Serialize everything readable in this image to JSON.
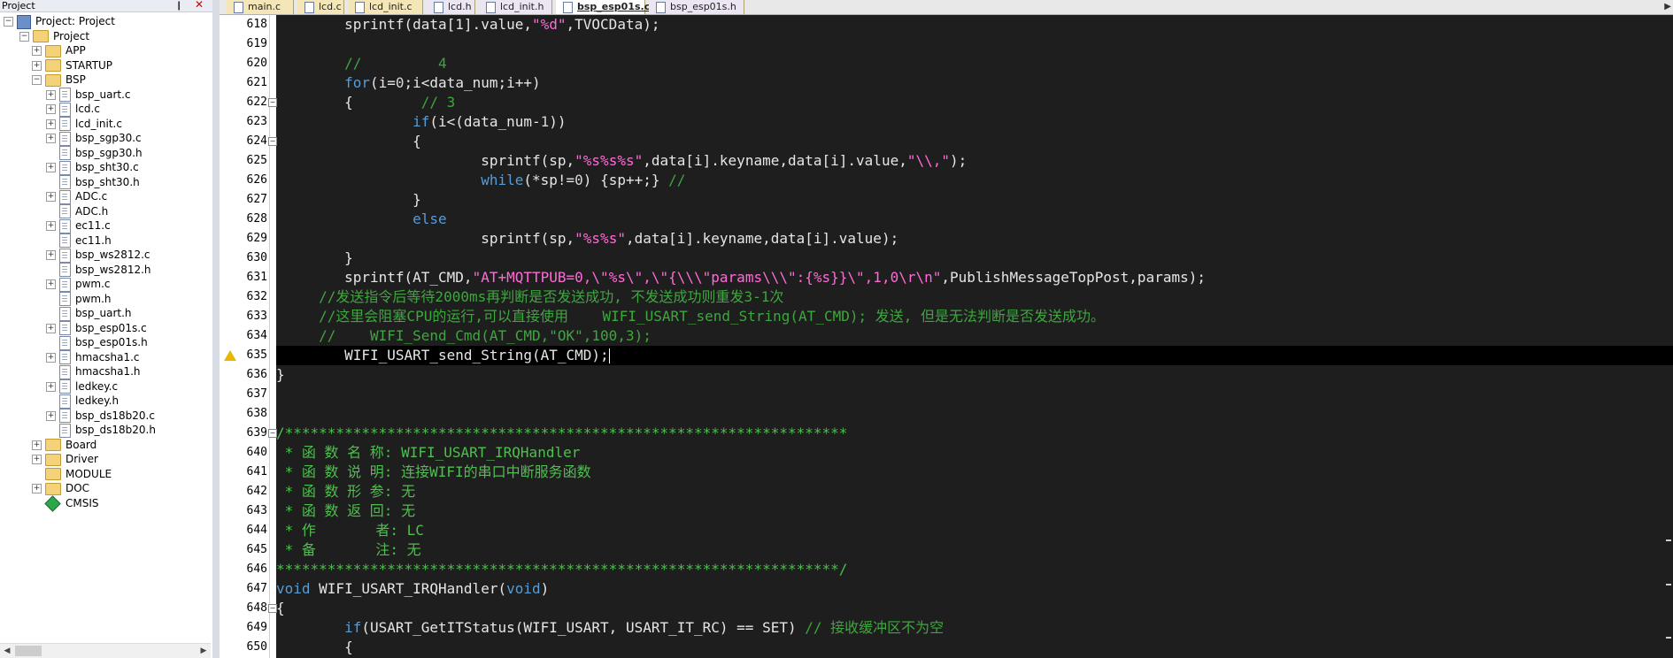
{
  "project_panel": {
    "title": "Project",
    "pin_glyph": "❙",
    "close_glyph": "✕",
    "tree": [
      {
        "label": "Project: Project",
        "indent": 0,
        "icon": "project-icon",
        "expander": "-"
      },
      {
        "label": "Project",
        "indent": 1,
        "icon": "folder-icon",
        "expander": "-"
      },
      {
        "label": "APP",
        "indent": 2,
        "icon": "folder-icon",
        "expander": "+"
      },
      {
        "label": "STARTUP",
        "indent": 2,
        "icon": "folder-icon",
        "expander": "+"
      },
      {
        "label": "BSP",
        "indent": 2,
        "icon": "folder-icon",
        "expander": "-"
      },
      {
        "label": "bsp_uart.c",
        "indent": 3,
        "icon": "file-icon",
        "expander": "+"
      },
      {
        "label": "lcd.c",
        "indent": 3,
        "icon": "file-icon",
        "expander": "+"
      },
      {
        "label": "lcd_init.c",
        "indent": 3,
        "icon": "file-icon",
        "expander": "+"
      },
      {
        "label": "bsp_sgp30.c",
        "indent": 3,
        "icon": "file-icon",
        "expander": "+"
      },
      {
        "label": "bsp_sgp30.h",
        "indent": 3,
        "icon": "file-icon",
        "expander": ""
      },
      {
        "label": "bsp_sht30.c",
        "indent": 3,
        "icon": "file-icon",
        "expander": "+"
      },
      {
        "label": "bsp_sht30.h",
        "indent": 3,
        "icon": "file-icon",
        "expander": ""
      },
      {
        "label": "ADC.c",
        "indent": 3,
        "icon": "file-icon",
        "expander": "+"
      },
      {
        "label": "ADC.h",
        "indent": 3,
        "icon": "file-icon",
        "expander": ""
      },
      {
        "label": "ec11.c",
        "indent": 3,
        "icon": "file-icon",
        "expander": "+"
      },
      {
        "label": "ec11.h",
        "indent": 3,
        "icon": "file-icon",
        "expander": ""
      },
      {
        "label": "bsp_ws2812.c",
        "indent": 3,
        "icon": "file-icon",
        "expander": "+"
      },
      {
        "label": "bsp_ws2812.h",
        "indent": 3,
        "icon": "file-icon",
        "expander": ""
      },
      {
        "label": "pwm.c",
        "indent": 3,
        "icon": "file-icon",
        "expander": "+"
      },
      {
        "label": "pwm.h",
        "indent": 3,
        "icon": "file-icon",
        "expander": ""
      },
      {
        "label": "bsp_uart.h",
        "indent": 3,
        "icon": "file-icon",
        "expander": ""
      },
      {
        "label": "bsp_esp01s.c",
        "indent": 3,
        "icon": "file-icon",
        "expander": "+"
      },
      {
        "label": "bsp_esp01s.h",
        "indent": 3,
        "icon": "file-icon",
        "expander": ""
      },
      {
        "label": "hmacsha1.c",
        "indent": 3,
        "icon": "file-icon",
        "expander": "+"
      },
      {
        "label": "hmacsha1.h",
        "indent": 3,
        "icon": "file-icon",
        "expander": ""
      },
      {
        "label": "ledkey.c",
        "indent": 3,
        "icon": "file-icon",
        "expander": "+"
      },
      {
        "label": "ledkey.h",
        "indent": 3,
        "icon": "file-icon",
        "expander": ""
      },
      {
        "label": "bsp_ds18b20.c",
        "indent": 3,
        "icon": "file-icon",
        "expander": "+"
      },
      {
        "label": "bsp_ds18b20.h",
        "indent": 3,
        "icon": "file-icon",
        "expander": ""
      },
      {
        "label": "Board",
        "indent": 2,
        "icon": "folder-icon",
        "expander": "+"
      },
      {
        "label": "Driver",
        "indent": 2,
        "icon": "folder-icon",
        "expander": "+"
      },
      {
        "label": "MODULE",
        "indent": 2,
        "icon": "folder-icon",
        "expander": ""
      },
      {
        "label": "DOC",
        "indent": 2,
        "icon": "folder-icon",
        "expander": "+"
      },
      {
        "label": "CMSIS",
        "indent": 2,
        "icon": "gem-icon",
        "expander": ""
      }
    ]
  },
  "tabs": [
    {
      "label": "main.c",
      "active": false,
      "kind": "c"
    },
    {
      "label": "lcd.c",
      "active": false,
      "kind": "c"
    },
    {
      "label": "lcd_init.c",
      "active": false,
      "kind": "c"
    },
    {
      "label": "lcd.h",
      "active": false,
      "kind": "h"
    },
    {
      "label": "lcd_init.h",
      "active": false,
      "kind": "h"
    },
    {
      "label": "bsp_esp01s.c",
      "active": true,
      "kind": "c"
    },
    {
      "label": "bsp_esp01s.h",
      "active": false,
      "kind": "h"
    }
  ],
  "editor": {
    "current_line": 635,
    "warning_line": 635,
    "lines": [
      {
        "n": 618,
        "fold": "",
        "parts": [
          [
            "p",
            "        sprintf(data[1].value,"
          ],
          [
            "s",
            "\"%d\""
          ],
          [
            "p",
            ",TVOCData);"
          ]
        ]
      },
      {
        "n": 619,
        "fold": "",
        "parts": []
      },
      {
        "n": 620,
        "fold": "",
        "parts": [
          [
            "c",
            "        //         4"
          ]
        ]
      },
      {
        "n": 621,
        "fold": "",
        "parts": [
          [
            "p",
            "        "
          ],
          [
            "k",
            "for"
          ],
          [
            "p",
            "(i="
          ],
          [
            "n",
            "0"
          ],
          [
            "p",
            ";i<data_num;i++)"
          ]
        ]
      },
      {
        "n": 622,
        "fold": "-",
        "parts": [
          [
            "p",
            "        {        "
          ],
          [
            "c",
            "// 3"
          ]
        ]
      },
      {
        "n": 623,
        "fold": "",
        "parts": [
          [
            "p",
            "                "
          ],
          [
            "k",
            "if"
          ],
          [
            "p",
            "(i<(data_num-"
          ],
          [
            "n",
            "1"
          ],
          [
            "p",
            "))"
          ]
        ]
      },
      {
        "n": 624,
        "fold": "-",
        "parts": [
          [
            "p",
            "                {"
          ]
        ]
      },
      {
        "n": 625,
        "fold": "",
        "parts": [
          [
            "p",
            "                        sprintf(sp,"
          ],
          [
            "s",
            "\"%s%s%s\""
          ],
          [
            "p",
            ",data[i].keyname,data[i].value,"
          ],
          [
            "s",
            "\"\\\\,\""
          ],
          [
            "p",
            ");"
          ]
        ]
      },
      {
        "n": 626,
        "fold": "",
        "parts": [
          [
            "p",
            "                        "
          ],
          [
            "k",
            "while"
          ],
          [
            "p",
            "(*sp!="
          ],
          [
            "n",
            "0"
          ],
          [
            "p",
            ") {sp++;} "
          ],
          [
            "c",
            "//"
          ]
        ]
      },
      {
        "n": 627,
        "fold": "",
        "parts": [
          [
            "p",
            "                }"
          ]
        ]
      },
      {
        "n": 628,
        "fold": "",
        "parts": [
          [
            "p",
            "                "
          ],
          [
            "k",
            "else"
          ]
        ]
      },
      {
        "n": 629,
        "fold": "",
        "parts": [
          [
            "p",
            "                        sprintf(sp,"
          ],
          [
            "s",
            "\"%s%s\""
          ],
          [
            "p",
            ",data[i].keyname,data[i].value);"
          ]
        ]
      },
      {
        "n": 630,
        "fold": "",
        "parts": [
          [
            "p",
            "        }"
          ]
        ]
      },
      {
        "n": 631,
        "fold": "",
        "parts": [
          [
            "p",
            "        sprintf(AT_CMD,"
          ],
          [
            "s",
            "\"AT+MQTTPUB=0,\\\"%s\\\",\\\"{\\\\\\\"params\\\\\\\":{%s}}\\\",1,0\\r\\n\""
          ],
          [
            "p",
            ",PublishMessageTopPost,params);"
          ]
        ]
      },
      {
        "n": 632,
        "fold": "",
        "parts": [
          [
            "c",
            "     //发送指令后等待2000ms再判断是否发送成功, 不发送成功则重发3-1次"
          ]
        ]
      },
      {
        "n": 633,
        "fold": "",
        "parts": [
          [
            "c",
            "     //这里会阻塞CPU的运行,可以直接使用    WIFI_USART_send_String(AT_CMD); 发送, 但是无法判断是否发送成功。"
          ]
        ]
      },
      {
        "n": 634,
        "fold": "",
        "parts": [
          [
            "c",
            "     //    WIFI_Send_Cmd(AT_CMD,\"OK\",100,3);"
          ]
        ]
      },
      {
        "n": 635,
        "fold": "",
        "parts": [
          [
            "p",
            "        WIFI_USART_send_String(AT_CMD);"
          ]
        ]
      },
      {
        "n": 636,
        "fold": "",
        "parts": [
          [
            "p",
            "}"
          ]
        ]
      },
      {
        "n": 637,
        "fold": "",
        "parts": []
      },
      {
        "n": 638,
        "fold": "",
        "parts": []
      },
      {
        "n": 639,
        "fold": "-",
        "parts": [
          [
            "b",
            "/******************************************************************"
          ]
        ]
      },
      {
        "n": 640,
        "fold": "",
        "parts": [
          [
            "b",
            " * 函 数 名 称: WIFI_USART_IRQHandler"
          ]
        ]
      },
      {
        "n": 641,
        "fold": "",
        "parts": [
          [
            "b",
            " * 函 数 说 明: 连接WIFI的串口中断服务函数"
          ]
        ]
      },
      {
        "n": 642,
        "fold": "",
        "parts": [
          [
            "b",
            " * 函 数 形 参: 无"
          ]
        ]
      },
      {
        "n": 643,
        "fold": "",
        "parts": [
          [
            "b",
            " * 函 数 返 回: 无"
          ]
        ]
      },
      {
        "n": 644,
        "fold": "",
        "parts": [
          [
            "b",
            " * 作       者: LC"
          ]
        ]
      },
      {
        "n": 645,
        "fold": "",
        "parts": [
          [
            "b",
            " * 备       注: 无"
          ]
        ]
      },
      {
        "n": 646,
        "fold": "",
        "parts": [
          [
            "b",
            "******************************************************************/"
          ]
        ]
      },
      {
        "n": 647,
        "fold": "",
        "parts": [
          [
            "k",
            "void"
          ],
          [
            "p",
            " WIFI_USART_IRQHandler("
          ],
          [
            "k",
            "void"
          ],
          [
            "p",
            ")"
          ]
        ]
      },
      {
        "n": 648,
        "fold": "-",
        "parts": [
          [
            "p",
            "{"
          ]
        ]
      },
      {
        "n": 649,
        "fold": "",
        "parts": [
          [
            "p",
            "        "
          ],
          [
            "k",
            "if"
          ],
          [
            "p",
            "(USART_GetITStatus(WIFI_USART, USART_IT_RC) == SET) "
          ],
          [
            "c",
            "// 接收缓冲区不为空"
          ]
        ]
      },
      {
        "n": 650,
        "fold": "",
        "parts": [
          [
            "p",
            "        {"
          ]
        ]
      }
    ]
  }
}
